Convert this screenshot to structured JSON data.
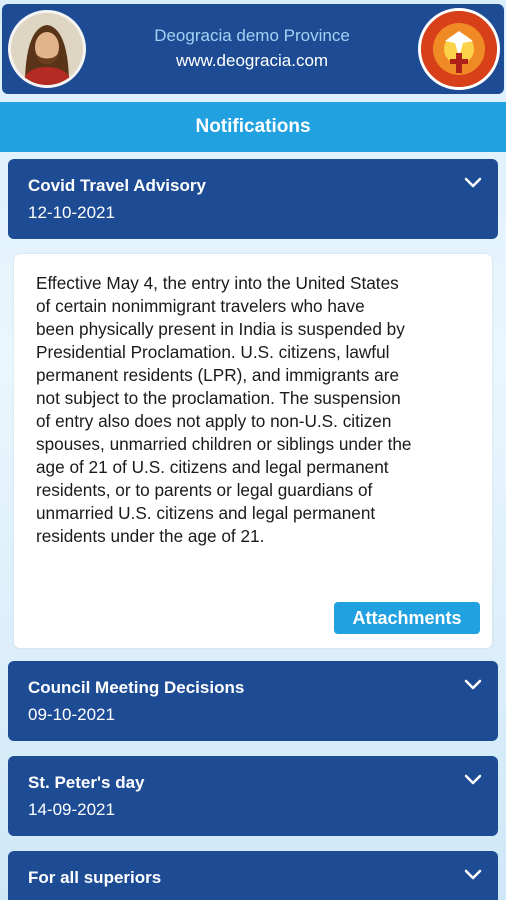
{
  "header": {
    "title": "Deogracia demo Province",
    "url": "www.deogracia.com",
    "avatar_icon": "jesus-portrait-icon",
    "logo_icon": "holy-spirit-dove-logo-icon"
  },
  "page": {
    "title": "Notifications"
  },
  "notifications": [
    {
      "title": "Covid Travel Advisory",
      "date": "12-10-2021",
      "expanded": true,
      "body": "Effective May 4, the entry into the United States\nof certain nonimmigrant travelers who have\nbeen physically present in India is suspended by\nPresidential Proclamation.  U.S. citizens, lawful\npermanent residents (LPR), and immigrants are\nnot subject to the proclamation.  The suspension\nof entry also does not apply to non-U.S. citizen\nspouses, unmarried children or siblings under the\nage of 21 of U.S. citizens and legal permanent\nresidents, or to parents or legal guardians of\nunmarried U.S. citizens and legal permanent\nresidents under the age of 21.",
      "attachments_label": "Attachments"
    },
    {
      "title": "Council Meeting Decisions",
      "date": "09-10-2021",
      "expanded": false
    },
    {
      "title": "St. Peter's day",
      "date": "14-09-2021",
      "expanded": false
    },
    {
      "title": "For all superiors",
      "date": "",
      "expanded": false
    }
  ],
  "colors": {
    "header_bg": "#1e4c94",
    "accent": "#21a1e0",
    "card_bg": "#1e4c94",
    "subtitle_text": "#9fd3f5"
  }
}
